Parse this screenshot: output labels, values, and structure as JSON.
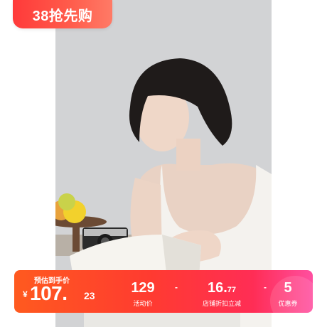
{
  "promo": {
    "label": "38抢先购"
  },
  "price_banner": {
    "pre_label": "预估到手价",
    "currency": "¥",
    "amount_int": "107.",
    "amount_dec": "23",
    "items": [
      {
        "value": "129",
        "caption": "活动价"
      },
      {
        "value_main": "16.",
        "value_small": "77",
        "caption": "店铺折扣立减"
      },
      {
        "value": "5",
        "caption": "优惠券"
      }
    ],
    "operators": [
      "-",
      "-"
    ]
  },
  "colors": {
    "promo_start": "#ff3a3a",
    "banner_start": "#ff5a1f",
    "banner_end": "#ff4fa0"
  }
}
